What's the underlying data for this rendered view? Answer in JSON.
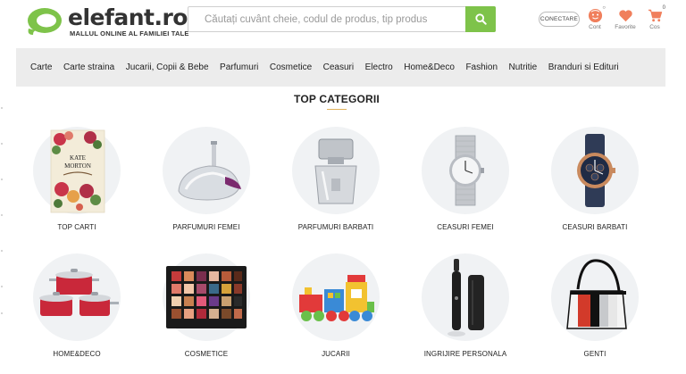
{
  "header": {
    "logo_name": "elefant.ro",
    "logo_tagline": "MALLUL ONLINE AL FAMILIEI TALE",
    "search_placeholder": "Căutați cuvânt cheie, codul de produs, tip produs",
    "login_label": "CONECTARE",
    "account_label": "Cont",
    "favorites_label": "Favorite",
    "cart_label": "Cos",
    "cart_count": "0",
    "brand_color": "#7ec34a",
    "accent_color": "#f07f5c"
  },
  "nav": {
    "items": [
      "Carte",
      "Carte straina",
      "Jucarii, Copii & Bebe",
      "Parfumuri",
      "Cosmetice",
      "Ceasuri",
      "Electro",
      "Home&Deco",
      "Fashion",
      "Nutritie",
      "Branduri si Edituri"
    ]
  },
  "section": {
    "title": "TOP CATEGORII"
  },
  "categories": [
    {
      "label": "TOP CARTI",
      "icon": "book-icon"
    },
    {
      "label": "PARFUMURI FEMEI",
      "icon": "perfume-women-icon"
    },
    {
      "label": "PARFUMURI BARBATI",
      "icon": "perfume-men-icon"
    },
    {
      "label": "CEASURI FEMEI",
      "icon": "watch-women-icon"
    },
    {
      "label": "CEASURI BARBATI",
      "icon": "watch-men-icon"
    },
    {
      "label": "HOME&DECO",
      "icon": "cookware-icon"
    },
    {
      "label": "COSMETICE",
      "icon": "palette-icon"
    },
    {
      "label": "JUCARII",
      "icon": "toy-train-icon"
    },
    {
      "label": "INGRIJIRE PERSONALA",
      "icon": "toothbrush-icon"
    },
    {
      "label": "GENTI",
      "icon": "handbag-icon"
    }
  ],
  "book_cover": {
    "author_line1": "KATE",
    "author_line2": "MORTON"
  }
}
